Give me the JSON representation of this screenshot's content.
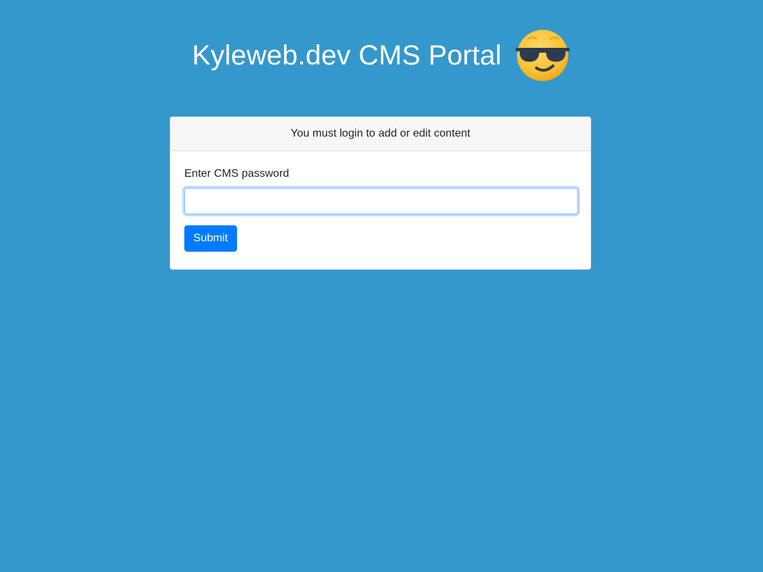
{
  "page": {
    "background_color": "#3498cd"
  },
  "header": {
    "title": "Kyleweb.dev CMS Portal",
    "emoji_icon": "smiling-face-with-sunglasses-icon"
  },
  "login_card": {
    "header_text": "You must login to add or edit content",
    "password_label": "Enter CMS password",
    "password_value": "",
    "password_placeholder": "",
    "submit_label": "Submit",
    "submit_color": "#007bff"
  }
}
